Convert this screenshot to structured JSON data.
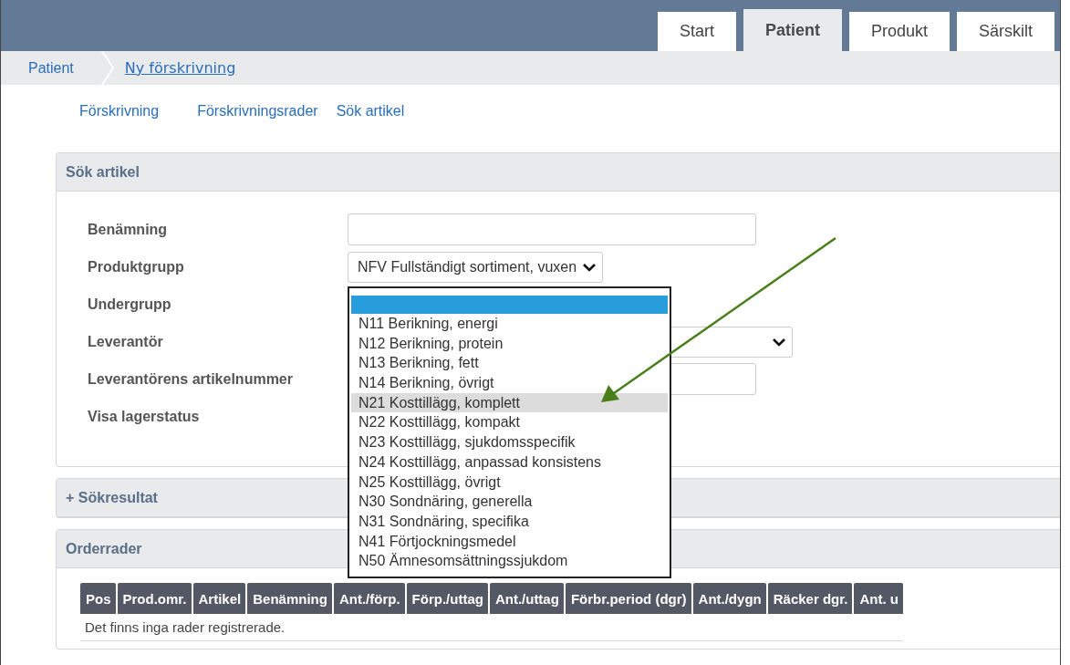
{
  "tabs": [
    {
      "label": "Start",
      "selected": false
    },
    {
      "label": "Patient",
      "selected": true
    },
    {
      "label": "Produkt",
      "selected": false
    },
    {
      "label": "Särskilt",
      "selected": false
    }
  ],
  "breadcrumb": [
    {
      "label": "Patient",
      "current": false
    },
    {
      "label": "Ny förskrivning",
      "current": true
    }
  ],
  "subnav": [
    "Förskrivning",
    "Förskrivningsrader",
    "Sök artikel"
  ],
  "search_panel": {
    "title": "Sök artikel",
    "fields": [
      {
        "label": "Benämning",
        "kind": "text"
      },
      {
        "label": "Produktgrupp",
        "kind": "select",
        "value": "NFV Fullständigt sortiment, vuxen"
      },
      {
        "label": "Undergrupp",
        "kind": "covered"
      },
      {
        "label": "Leverantör",
        "kind": "select-wide"
      },
      {
        "label": "Leverantörens artikelnummer",
        "kind": "text"
      },
      {
        "label": "Visa lagerstatus",
        "kind": "covered"
      }
    ],
    "dropdown": {
      "options": [
        {
          "selected": true,
          "highlighted": false
        },
        {
          "label": "N11 Berikning, energi",
          "selected": false,
          "highlighted": false
        },
        {
          "label": "N12 Berikning, protein",
          "selected": false,
          "highlighted": false
        },
        {
          "label": "N13 Berikning, fett",
          "selected": false,
          "highlighted": false
        },
        {
          "label": "N14 Berikning, övrigt",
          "selected": false,
          "highlighted": false
        },
        {
          "label": "N21 Kosttillägg, komplett",
          "selected": false,
          "highlighted": true
        },
        {
          "label": "N22 Kosttillägg, kompakt",
          "selected": false,
          "highlighted": false
        },
        {
          "label": "N23 Kosttillägg, sjukdomsspecifik",
          "selected": false,
          "highlighted": false
        },
        {
          "label": "N24 Kosttillägg, anpassad konsistens",
          "selected": false,
          "highlighted": false
        },
        {
          "label": "N25 Kosttillägg, övrigt",
          "selected": false,
          "highlighted": false
        },
        {
          "label": "N30 Sondnäring, generella",
          "selected": false,
          "highlighted": false
        },
        {
          "label": "N31 Sondnäring, specifika",
          "selected": false,
          "highlighted": false
        },
        {
          "label": "N41 Förtjockningsmedel",
          "selected": false,
          "highlighted": false
        },
        {
          "label": "N50 Ämnesomsättningssjukdom",
          "selected": false,
          "highlighted": false
        }
      ]
    }
  },
  "results_panel": {
    "title": "+ Sökresultat"
  },
  "order_panel": {
    "title": "Orderrader",
    "columns": [
      "Pos",
      "Prod.omr.",
      "Artikel",
      "Benämning",
      "Ant./förp.",
      "Förp./uttag",
      "Ant./uttag",
      "Förbr.period (dgr)",
      "Ant./dygn",
      "Räcker dgr.",
      "Ant. u"
    ],
    "empty_message": "Det finns inga rader registrerade."
  }
}
